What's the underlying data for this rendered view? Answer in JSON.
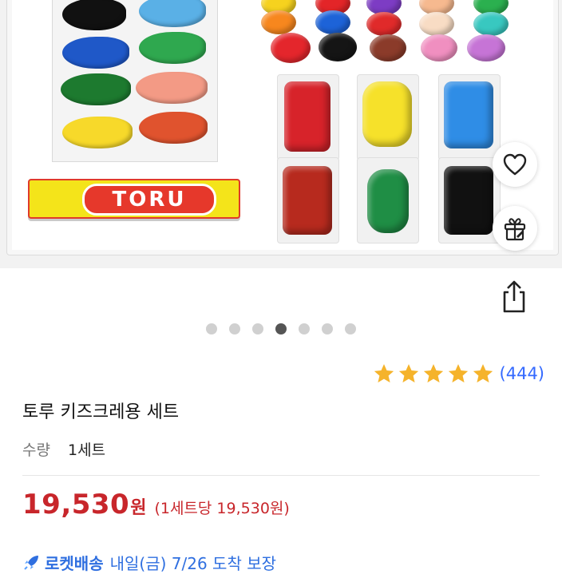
{
  "product": {
    "image": {
      "brand_label": "TORU",
      "carousel_dots": 7,
      "active_dot_index": 3
    },
    "actions": {
      "wishlist_icon": "heart-icon",
      "gift_icon": "gift-icon",
      "share_icon": "share-icon"
    },
    "rating": {
      "stars": 5,
      "count_text": "(444)",
      "star_color": "#f5b32b"
    },
    "title": "토루 키즈크레용 세트",
    "quantity": {
      "label": "수량",
      "value": "1세트"
    },
    "price": {
      "amount": "19,530",
      "unit": "원",
      "per_unit": "(1세트당 19,530원)",
      "color": "#c8262b"
    },
    "delivery": {
      "icon": "rocket-icon",
      "brand": "로켓배송",
      "text": "내일(금) 7/26 도착 보장",
      "color": "#2f6fe0"
    }
  }
}
